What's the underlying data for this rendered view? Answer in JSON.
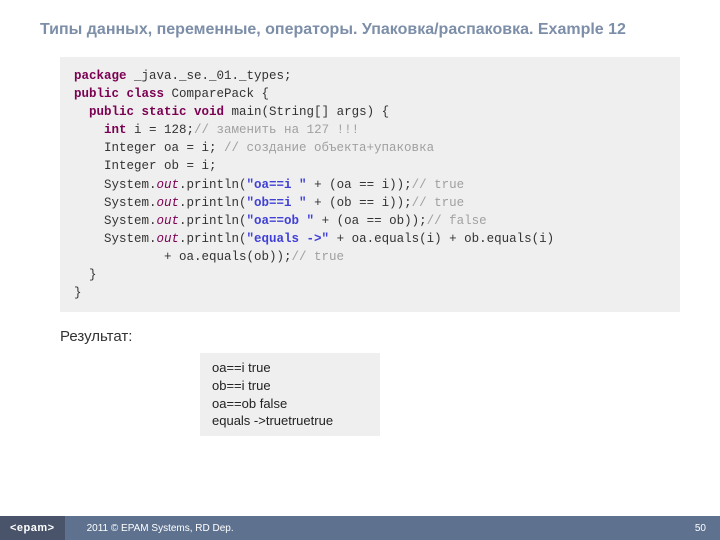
{
  "title": "Типы данных, переменные, операторы. Упаковка/распаковка. Example 12",
  "code": {
    "l1_kw": "package",
    "l1_rest": " _java._se._01._types;",
    "l2_kw": "public class",
    "l2_rest": " ComparePack {",
    "l3_kw": "public static void",
    "l3_rest": " main(String[] args) {",
    "l4_kw": "int",
    "l4_rest": " i = 128;",
    "l4_cmt": "// заменить на 127 !!!",
    "l5_a": "    Integer oa = i; ",
    "l5_cmt": "// создание объекта+упаковка",
    "l6": "    Integer ob = i;",
    "l7_a": "    System.",
    "l7_out": "out",
    "l7_b": ".println(",
    "l7_str": "\"oa==i \"",
    "l7_c": " + (oa == i));",
    "l7_cmt": "// true",
    "l8_a": "    System.",
    "l8_out": "out",
    "l8_b": ".println(",
    "l8_str": "\"ob==i \"",
    "l8_c": " + (ob == i));",
    "l8_cmt": "// true",
    "l9_a": "    System.",
    "l9_out": "out",
    "l9_b": ".println(",
    "l9_str": "\"oa==ob \"",
    "l9_c": " + (oa == ob));",
    "l9_cmt": "// false",
    "l10_a": "    System.",
    "l10_out": "out",
    "l10_b": ".println(",
    "l10_str": "\"equals ->\"",
    "l10_c": " + oa.equals(i) + ob.equals(i)",
    "l11_a": "            + oa.equals(ob));",
    "l11_cmt": "// true",
    "l12": "  }",
    "l13": "}"
  },
  "result_label": "Результат:",
  "result": "oa==i true\nob==i true\noa==ob false\nequals ->truetruetrue",
  "footer": {
    "logo": "<epam>",
    "text": "2011 © EPAM Systems, RD Dep.",
    "page": "50"
  }
}
